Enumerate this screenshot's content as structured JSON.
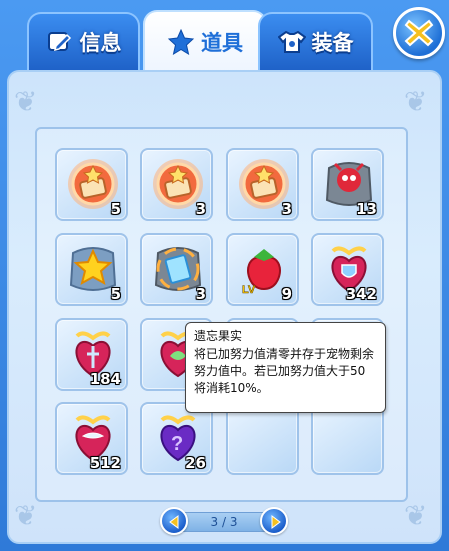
{
  "tabs": [
    {
      "label": "信息",
      "icon": "edit-icon",
      "active": false
    },
    {
      "label": "道具",
      "icon": "star-icon",
      "active": true
    },
    {
      "label": "装备",
      "icon": "shirt-icon",
      "active": false
    }
  ],
  "colors": {
    "accent": "#1f6fd8",
    "panel": "#d9ecfd",
    "count_text": "#ffffff"
  },
  "items": [
    {
      "icon": "crate-medal-icon",
      "count": "5"
    },
    {
      "icon": "crate-medal-icon",
      "count": "3"
    },
    {
      "icon": "crate-medal-icon",
      "count": "3"
    },
    {
      "icon": "red-monster-stone-icon",
      "count": "13"
    },
    {
      "icon": "star-stone-icon",
      "count": "5"
    },
    {
      "icon": "ice-crystal-stone-icon",
      "count": "3"
    },
    {
      "icon": "strawberry-fruit-icon",
      "count": "9",
      "badge": "LV"
    },
    {
      "icon": "heart-shield-potion-icon",
      "count": "342"
    },
    {
      "icon": "heart-sword-potion-icon",
      "count": "184"
    },
    {
      "icon": "heart-leaf-potion-icon",
      "count": ""
    },
    {
      "icon": "",
      "count": ""
    },
    {
      "icon": "",
      "count": ""
    },
    {
      "icon": "heart-wing-potion-icon",
      "count": "512"
    },
    {
      "icon": "purple-question-potion-icon",
      "count": "26"
    },
    {
      "icon": "",
      "count": ""
    },
    {
      "icon": "",
      "count": ""
    }
  ],
  "tooltip": {
    "title": "遗忘果实",
    "body": "将已加努力值清零并存于宠物剩余努力值中。若已加努力值大于50将消耗10%。"
  },
  "pager": {
    "text": "3 / 3",
    "current": 3,
    "total": 3
  }
}
